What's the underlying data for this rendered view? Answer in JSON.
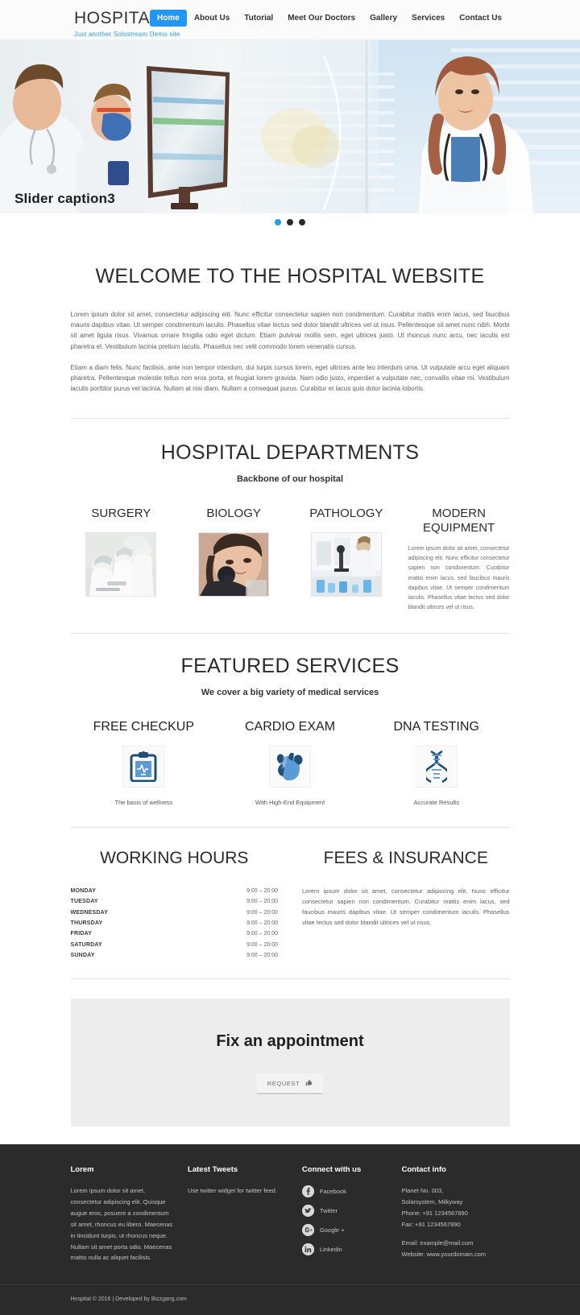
{
  "header": {
    "brand_title": "HOSPITAL",
    "brand_tagline": "Just another Solostream Demo site",
    "accent_color": "#2196f3",
    "nav": [
      {
        "label": "Home",
        "active": true
      },
      {
        "label": "About Us",
        "active": false
      },
      {
        "label": "Tutorial",
        "active": false
      },
      {
        "label": "Meet Our Doctors",
        "active": false
      },
      {
        "label": "Gallery",
        "active": false
      },
      {
        "label": "Services",
        "active": false
      },
      {
        "label": "Contact Us",
        "active": false
      }
    ]
  },
  "slider": {
    "caption": "Slider caption3",
    "dots": 3,
    "active_dot": 1,
    "active_dot_color": "#1ca2e3",
    "inactive_dot_color": "#2b2b2b"
  },
  "welcome": {
    "title": "WELCOME TO THE HOSPITAL WEBSITE",
    "paragraph1": "Lorem ipsum dolor sit amet, consectetur adipiscing elit. Nunc efficitur consectetur sapien non condimentum. Curabitur mattis enim lacus, sed faucibus mauris dapibus vitae. Ut semper condimentum iaculis. Phasellus vitae lectus sed dolor blandit ultrices vel ut risus. Pellentesque sit amet nunc nibh. Morbi sit amet ligula risus. Vivamus ornare fringilla odio eget dictum. Etiam pulvinar mollis sem, eget ultrices justo. Ut rhoncus nunc arcu, nec iaculis est pharetra et. Vestibulum lacinia pretium iaculis. Phasellus nec velit commodo lorem venenatis cursus.",
    "paragraph2": "Etiam a diam felis. Nunc facilisis, ante non tempor interdum, dui turpis cursus lorem, eget ultrices ante leo interdum urna. Ut vulputate arcu eget aliquam pharetra. Pellentesque molestie tellus non eros porta, et feugiat lorem gravida. Nam odio justo, imperdiet a vulputate nec, convallis vitae mi. Vestibulum iaculis porttitor purus vel lacinia. Nullam at nisi diam. Nullam a consequat purus. Curabitur et lacus quis dolor lacinia lobortis."
  },
  "departments": {
    "title": "HOSPITAL DEPARTMENTS",
    "subtitle": "Backbone of our hospital",
    "items": [
      {
        "name": "SURGERY",
        "image": "surgery-photo"
      },
      {
        "name": "BIOLOGY",
        "image": "biology-microscope-photo"
      },
      {
        "name": "PATHOLOGY",
        "image": "pathology-lab-photo"
      },
      {
        "name": "MODERN EQUIPMENT",
        "text": "Lorem ipsum dolor sit amet, consectetur adipiscing elit. Nunc efficitur consectetur sapien non condimentum. Curabitur mattis enim lacus, sed faucibus mauris dapibus vitae. Ut semper condimentum iaculis. Phasellus vitae lectus sed dolor blandit ultrices vel ut risus."
      }
    ]
  },
  "featured_services": {
    "title": "FEATURED SERVICES",
    "subtitle": "We cover a big variety of medical services",
    "items": [
      {
        "name": "FREE CHECKUP",
        "icon": "clipboard-ecg-icon",
        "caption": "The basis of wellness"
      },
      {
        "name": "CARDIO EXAM",
        "icon": "heart-icon",
        "caption": "With High-End Equipment"
      },
      {
        "name": "DNA TESTING",
        "icon": "dna-helix-icon",
        "caption": "Accurate Results"
      }
    ]
  },
  "working_hours": {
    "title": "WORKING HOURS",
    "rows": [
      {
        "day": "MONDAY",
        "time": "9:00 – 20:00"
      },
      {
        "day": "TUESDAY",
        "time": "9:00 – 20:00"
      },
      {
        "day": "WEDNESDAY",
        "time": "9:00 – 20:00"
      },
      {
        "day": "THURSDAY",
        "time": "9:00 – 20:00"
      },
      {
        "day": "FRIDAY",
        "time": "9:00 – 20:00"
      },
      {
        "day": "SATURDAY",
        "time": "9:00 – 20:00"
      },
      {
        "day": "SUNDAY",
        "time": "9:00 – 20:00"
      }
    ]
  },
  "fees": {
    "title": "FEES & INSURANCE",
    "text": "Lorem ipsum dolor sit amet, consectetur adipiscing elit. Nunc efficitur consectetur sapien non condimentum. Curabitur mattis enim lacus, sed faucibus mauris dapibus vitae. Ut semper condimentum iaculis. Phasellus vitae lectus sed dolor blandit ultrices vel ut risus."
  },
  "appointment": {
    "title": "Fix an appointment",
    "button_label": "REQUEST",
    "button_icon": "thumbs-up-icon"
  },
  "footer": {
    "col1": {
      "heading": "Lorem",
      "text": "Lorem ipsum dolor sit amet, consectetur adipiscing elit. Quisque augue eros, posuere a condimentum sit amet, rhoncus eu libero. Maecenas in tincidunt turpis, ut rhoncus neque. Nullam sit amet porta odio. Maecenas mattis nulla ac aliquet facilisis."
    },
    "col2": {
      "heading": "Latest Tweets",
      "text": "Use twitter widget for twitter feed."
    },
    "col3": {
      "heading": "Connect with us",
      "links": [
        {
          "label": "Facebook",
          "icon": "facebook-icon"
        },
        {
          "label": "Twitter",
          "icon": "twitter-icon"
        },
        {
          "label": "Google +",
          "icon": "google-plus-icon"
        },
        {
          "label": "Linkedin",
          "icon": "linkedin-icon"
        }
      ]
    },
    "col4": {
      "heading": "Contact info",
      "address_line1": "Planet No. 003,",
      "address_line2": "Solarsystem, Milkyway",
      "phone": "Phone: +91 1234567890",
      "fax": "Fax: +91 1234567890",
      "email": "Email: example@mail.com",
      "website": "Website: www.yourdomain.com"
    },
    "copyright": "Hospital © 2016 | Developed by  Bizzgang.com"
  }
}
